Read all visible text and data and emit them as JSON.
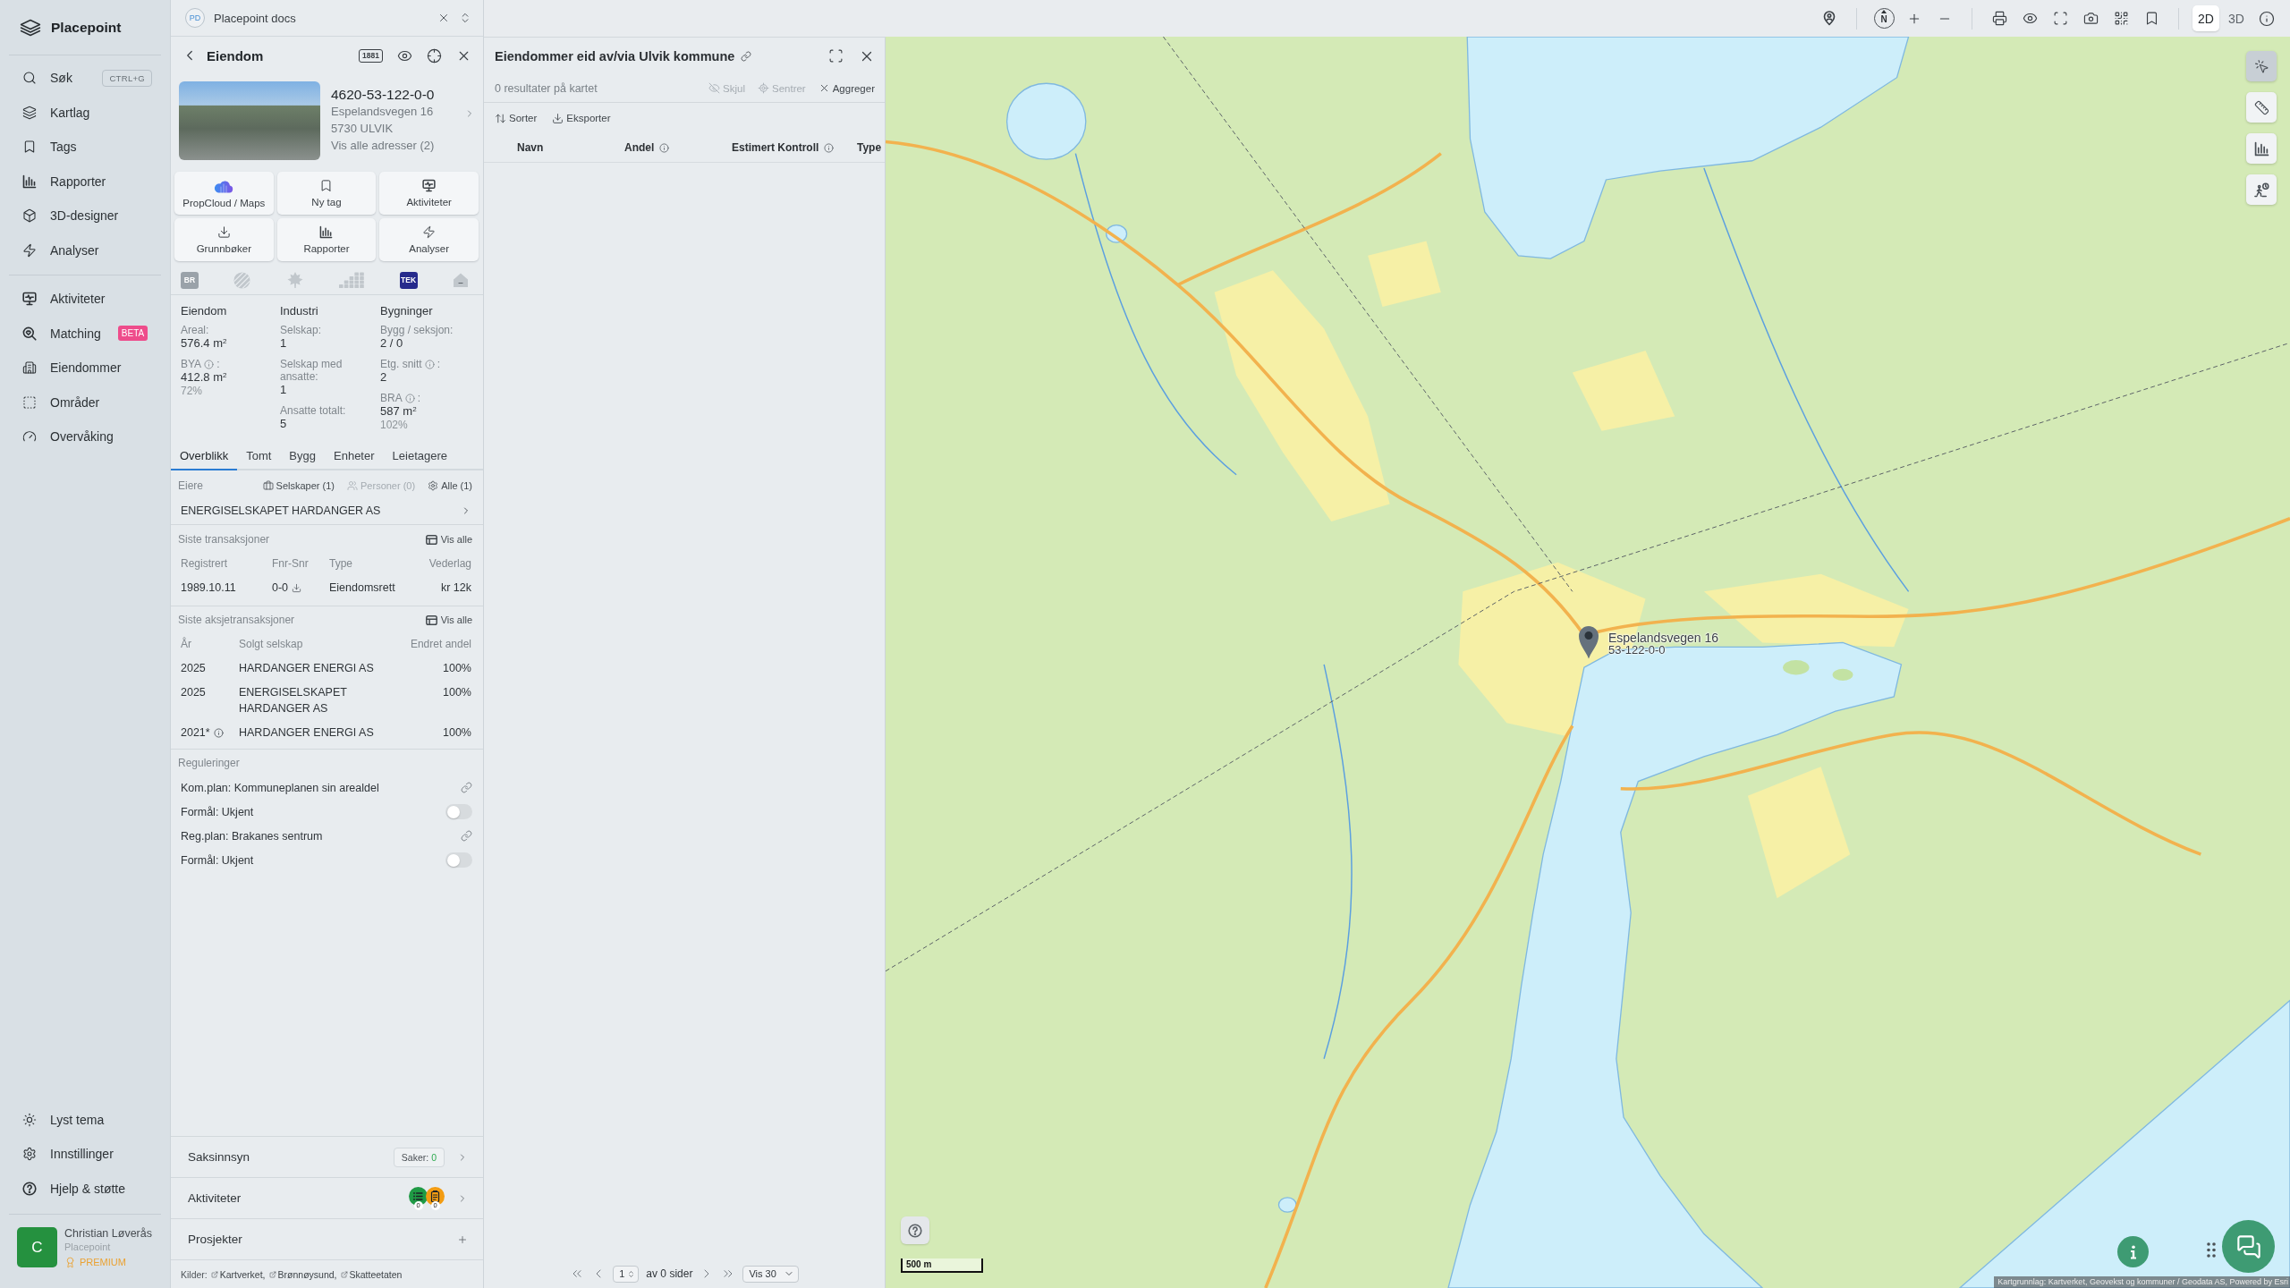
{
  "sidebar": {
    "brand": "Placepoint",
    "primary_nav": [
      {
        "label": "Søk",
        "shortcut": "CTRL+G",
        "selected": false
      },
      {
        "label": "Kartlag",
        "selected": false
      },
      {
        "label": "Tags",
        "selected": false
      },
      {
        "label": "Rapporter",
        "selected": false
      },
      {
        "label": "3D-designer",
        "selected": false
      },
      {
        "label": "Analyser",
        "selected": false
      }
    ],
    "secondary_nav": [
      {
        "label": "Aktiviteter",
        "selected": false
      },
      {
        "label": "Matching",
        "badge": "BETA",
        "selected": false
      },
      {
        "label": "Eiendommer",
        "selected": false
      },
      {
        "label": "Områder",
        "selected": false
      },
      {
        "label": "Overvåking",
        "selected": false
      }
    ],
    "footer_nav": [
      "Lyst tema",
      "Innstillinger",
      "Hjelp & støtte"
    ],
    "user": {
      "initial": "C",
      "name": "Christian Løverås",
      "organization": "Placepoint",
      "plan": "PREMIUM"
    }
  },
  "workspace": {
    "initials": "PD",
    "name": "Placepoint docs"
  },
  "property_panel": {
    "title": "Eiendom",
    "directory_badge": "1881",
    "property": {
      "id": "4620-53-122-0-0",
      "address": "Espelandsvegen 16",
      "postal_place": "5730 ULVIK",
      "addresses_link": "Vis alle adresser (2)"
    },
    "actions": [
      "PropCloud / Maps",
      "Ny tag",
      "Aktiviteter",
      "Grunnbøker",
      "Rapporter",
      "Analyser"
    ],
    "registers": [
      {
        "label": "BR",
        "active": false
      },
      {
        "active": false
      },
      {
        "active": false
      },
      {
        "active": false
      },
      {
        "label": "TEK",
        "active": true
      },
      {
        "active": false
      }
    ],
    "stats": [
      {
        "heading": "Eiendom",
        "fields": [
          {
            "label": "Areal:",
            "value": "576.4 m$^{2}$"
          },
          {
            "label": "BYA",
            "info": true,
            "label_end": ":",
            "value": "412.8 m$^{2}$",
            "note": "72%"
          }
        ]
      },
      {
        "heading": "Industri",
        "fields": [
          {
            "label": "Selskap:",
            "value": "1"
          },
          {
            "label": "Selskap med ansatte:",
            "value": "1"
          },
          {
            "label": "Ansatte totalt:",
            "value": "5"
          }
        ]
      },
      {
        "heading": "Bygninger",
        "fields": [
          {
            "label": "Bygg / seksjon:",
            "value": "2 / 0"
          },
          {
            "label": "Etg. snitt",
            "info": true,
            "label_end": ":",
            "value": "2"
          },
          {
            "label": "BRA",
            "info": true,
            "label_end": ":",
            "value": "587 m$^{2}$",
            "note": "102%"
          }
        ]
      }
    ],
    "tabs": [
      {
        "label": "Overblikk",
        "selected": true
      },
      {
        "label": "Tomt",
        "selected": false
      },
      {
        "label": "Bygg",
        "selected": false
      },
      {
        "label": "Enheter",
        "selected": false
      },
      {
        "label": "Leietagere",
        "selected": false
      }
    ],
    "owners": {
      "label": "Eiere",
      "filters": [
        {
          "label": "Selskaper (1)",
          "disabled": false
        },
        {
          "label": "Personer (0)",
          "disabled": true
        },
        {
          "label": "Alle (1)",
          "disabled": false
        }
      ],
      "rows": [
        "ENERGISELSKAPET HARDANGER AS"
      ]
    },
    "transactions": {
      "title": "Siste transaksjoner",
      "link": "Vis alle",
      "columns": [
        "Registrert",
        "Fnr-Snr",
        "Type",
        "Vederlag"
      ],
      "rows": [
        [
          "1989.10.11",
          "0-0",
          "Eiendomsrett",
          "kr 12k"
        ]
      ]
    },
    "share_transactions": {
      "title": "Siste aksjetransaksjoner",
      "link": "Vis alle",
      "columns": [
        "År",
        "Solgt selskap",
        "Endret andel"
      ],
      "rows": [
        {
          "cells": [
            "2025",
            "HARDANGER ENERGI AS",
            "100%"
          ]
        },
        {
          "cells": [
            "2025",
            "ENERGISELSKAPET HARDANGER AS",
            "100%"
          ]
        },
        {
          "cells": [
            "2021*",
            "HARDANGER ENERGI AS",
            "100%"
          ],
          "info": true
        }
      ]
    },
    "regulations": {
      "title": "Reguleringer",
      "items": [
        {
          "kind": "link",
          "label": "Kom.plan: Kommuneplanen sin arealdel"
        },
        {
          "kind": "toggle",
          "label": "Formål: Ukjent",
          "on": false
        },
        {
          "kind": "link",
          "label": "Reg.plan: Brakanes sentrum"
        },
        {
          "kind": "toggle",
          "label": "Formål: Ukjent",
          "on": false
        }
      ]
    },
    "sections": [
      {
        "kind": "cases",
        "label": "Saksinnsyn",
        "count_label": "Saker:",
        "count": "0"
      },
      {
        "kind": "activities",
        "label": "Aktiviteter",
        "badges": [
          {
            "count": "0",
            "color": "#1f9a45"
          },
          {
            "count": "0",
            "color": "#f39c12"
          }
        ]
      },
      {
        "kind": "add",
        "label": "Prosjekter"
      }
    ],
    "sources": {
      "label": "Kilder:",
      "links": [
        "Kartverket,",
        "Brønnøysund,",
        "Skatteetaten"
      ]
    }
  },
  "results_panel": {
    "title": "Eiendommer eid av/via Ulvik kommune",
    "summary": "0 resultater på kartet",
    "actions": [
      {
        "label": "Skjul",
        "disabled": true
      },
      {
        "label": "Sentrer",
        "disabled": true
      },
      {
        "label": "Aggreger",
        "disabled": false
      }
    ],
    "tools": [
      "Sorter",
      "Eksporter"
    ],
    "columns": [
      {
        "label": "Navn"
      },
      {
        "label": "Andel",
        "info": true
      },
      {
        "label": "Estimert Kontroll",
        "info": true
      },
      {
        "label": "Type"
      }
    ],
    "pagination": {
      "page": "1",
      "pages": "av 0 sider",
      "page_size": "Vis 30"
    }
  },
  "map": {
    "toolbar": {
      "compass": "N",
      "modes": [
        {
          "label": "2D",
          "selected": true
        },
        {
          "label": "3D",
          "selected": false
        }
      ]
    },
    "tools": [
      {
        "selected": true
      },
      {
        "selected": false
      },
      {
        "selected": false
      },
      {
        "selected": false
      }
    ],
    "marker": {
      "title": "Espelandsvegen 16",
      "subtitle": "53-122-0-0"
    },
    "scale": "500 m",
    "attribution": "Kartgrunnlag: Kartverket, Geovekst og kommuner / Geodata AS, Powered by Esri"
  }
}
